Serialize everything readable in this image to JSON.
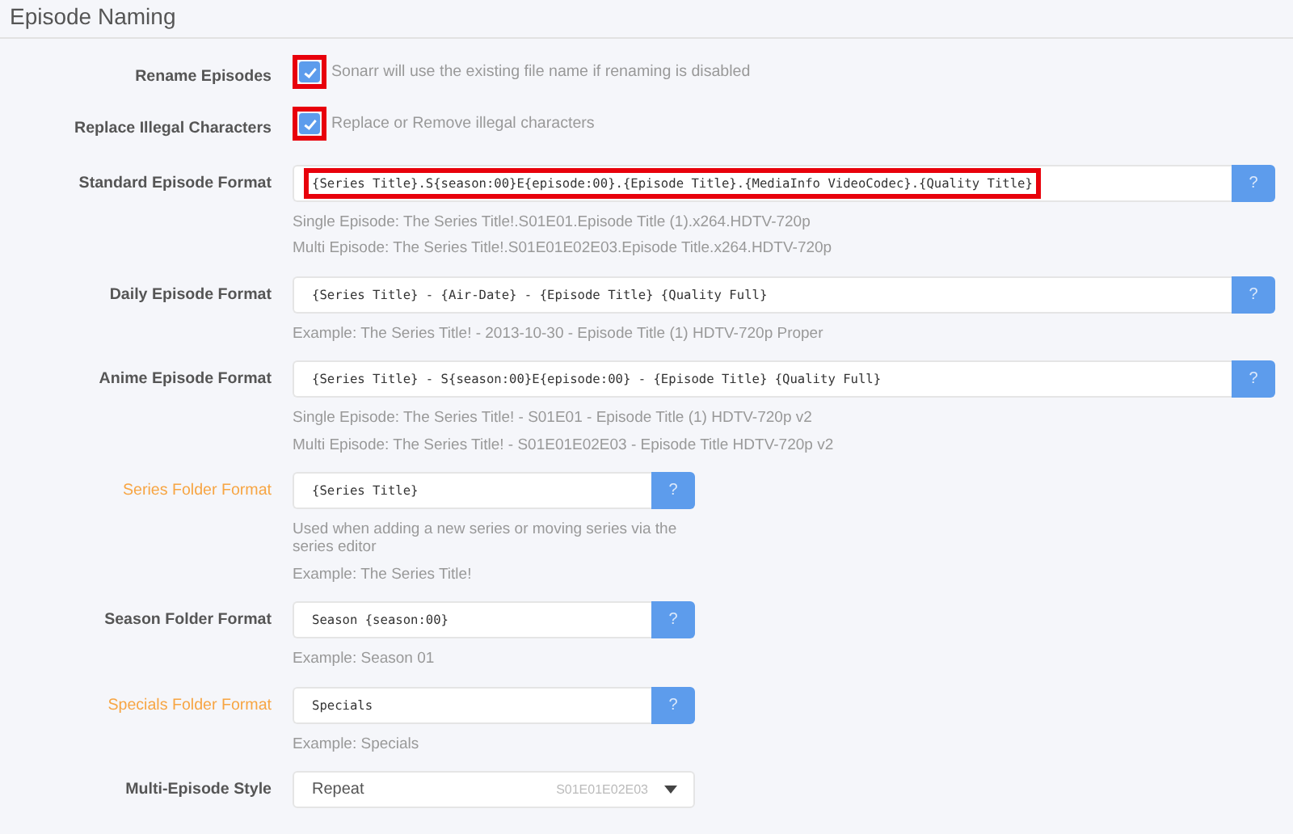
{
  "section": {
    "title": "Episode Naming"
  },
  "rows": [
    {
      "kind": "checkbox",
      "label": "Rename Episodes",
      "advanced": false,
      "checked": true,
      "highlighted": true,
      "hint": "Sonarr will use the existing file name if renaming is disabled"
    },
    {
      "kind": "checkbox",
      "label": "Replace Illegal Characters",
      "advanced": false,
      "checked": true,
      "highlighted": true,
      "hint": "Replace or Remove illegal characters"
    },
    {
      "kind": "format",
      "label": "Standard Episode Format",
      "advanced": false,
      "value": "{Series Title}.S{season:00}E{episode:00}.{Episode Title}.{MediaInfo VideoCodec}.{Quality Title}",
      "highlighted": true,
      "button": "?",
      "help": [
        "Single Episode: The Series Title!.S01E01.Episode Title (1).x264.HDTV-720p",
        "Multi Episode: The Series Title!.S01E01E02E03.Episode Title.x264.HDTV-720p"
      ]
    },
    {
      "kind": "format",
      "label": "Daily Episode Format",
      "advanced": false,
      "value": "{Series Title} - {Air-Date} - {Episode Title} {Quality Full}",
      "highlighted": false,
      "button": "?",
      "help": [
        "Example: The Series Title! - 2013-10-30 - Episode Title (1) HDTV-720p Proper"
      ]
    },
    {
      "kind": "format",
      "label": "Anime Episode Format",
      "advanced": false,
      "value": "{Series Title} - S{season:00}E{episode:00} - {Episode Title} {Quality Full}",
      "highlighted": false,
      "button": "?",
      "help": [
        "Single Episode: The Series Title! - S01E01 - Episode Title (1) HDTV-720p v2",
        "Multi Episode: The Series Title! - S01E01E02E03 - Episode Title HDTV-720p v2"
      ]
    },
    {
      "kind": "folder",
      "label": "Series Folder Format",
      "advanced": true,
      "value": "{Series Title}",
      "highlighted": false,
      "button": "?",
      "help": [
        "Used when adding a new series or moving series via the series editor",
        "Example: The Series Title!"
      ]
    },
    {
      "kind": "folder",
      "label": "Season Folder Format",
      "advanced": false,
      "value": "Season {season:00}",
      "highlighted": false,
      "button": "?",
      "help": [
        "Example: Season 01"
      ]
    },
    {
      "kind": "folder",
      "label": "Specials Folder Format",
      "advanced": true,
      "value": "Specials",
      "highlighted": false,
      "button": "?",
      "help": [
        "Example: Specials"
      ]
    },
    {
      "kind": "select",
      "label": "Multi-Episode Style",
      "advanced": false,
      "value": "Repeat",
      "example": "S01E01E02E03"
    }
  ]
}
